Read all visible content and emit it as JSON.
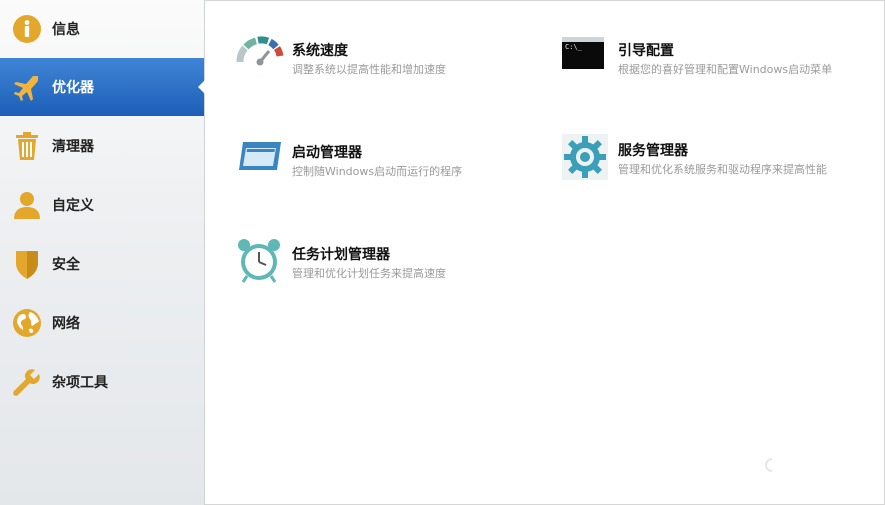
{
  "sidebar": {
    "items": [
      {
        "label": "信息",
        "icon": "info-icon",
        "active": false
      },
      {
        "label": "优化器",
        "icon": "airplane-icon",
        "active": true
      },
      {
        "label": "清理器",
        "icon": "trash-icon",
        "active": false
      },
      {
        "label": "自定义",
        "icon": "user-icon",
        "active": false
      },
      {
        "label": "安全",
        "icon": "shield-icon",
        "active": false
      },
      {
        "label": "网络",
        "icon": "globe-icon",
        "active": false
      },
      {
        "label": "杂项工具",
        "icon": "wrench-icon",
        "active": false
      }
    ]
  },
  "main": {
    "tiles": [
      {
        "title": "系统速度",
        "desc": "调整系统以提高性能和增加速度",
        "icon": "speedometer-icon"
      },
      {
        "title": "引导配置",
        "desc": "根据您的喜好管理和配置Windows启动菜单",
        "icon": "console-icon",
        "console_text": "C:\\_"
      },
      {
        "title": "启动管理器",
        "desc": "控制随Windows启动而运行的程序",
        "icon": "window-icon"
      },
      {
        "title": "服务管理器",
        "desc": "管理和优化系统服务和驱动程序来提高性能",
        "icon": "gear-icon"
      },
      {
        "title": "任务计划管理器",
        "desc": "管理和优化计划任务来提高速度",
        "icon": "alarm-clock-icon"
      }
    ]
  },
  "colors": {
    "active_nav": "#2c6fc8",
    "icon_gold": "#e3a72b",
    "icon_teal": "#3a9fb8",
    "desc_gray": "#9a9a9a"
  }
}
